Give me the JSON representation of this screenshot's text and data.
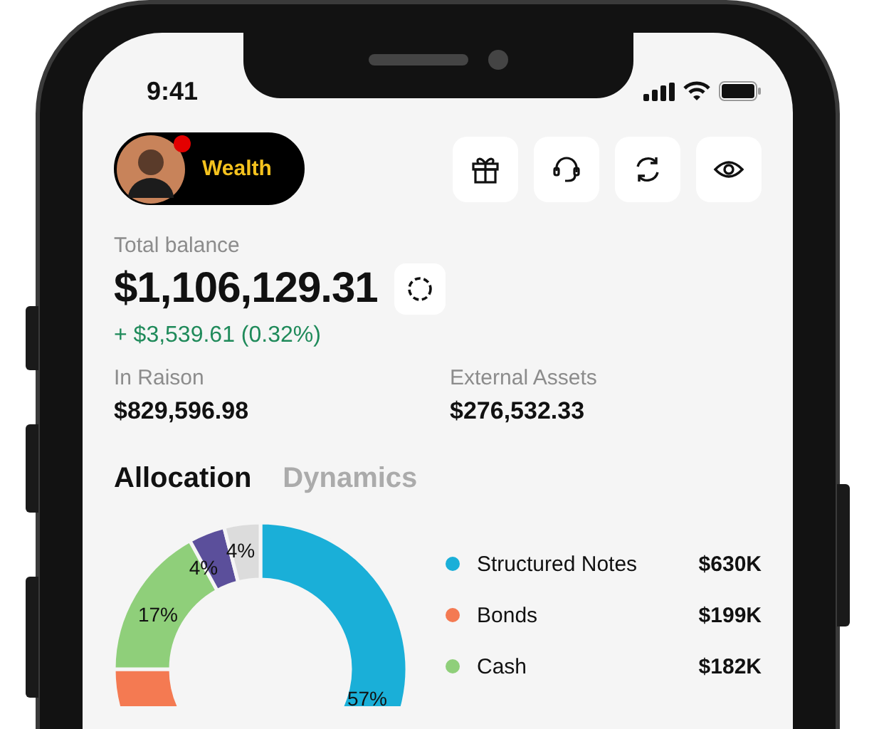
{
  "status_bar": {
    "time": "9:41"
  },
  "header": {
    "account_label": "Wealth",
    "notification": true
  },
  "balance": {
    "label": "Total balance",
    "value": "$1,106,129.31",
    "change": "+ $3,539.61 (0.32%)"
  },
  "breakdown": [
    {
      "label": "In Raison",
      "value": "$829,596.98"
    },
    {
      "label": "External Assets",
      "value": "$276,532.33"
    }
  ],
  "tabs": [
    {
      "label": "Allocation",
      "selected": true
    },
    {
      "label": "Dynamics",
      "selected": false
    }
  ],
  "allocation": {
    "chart_data": {
      "type": "donut",
      "values": [
        57,
        18,
        17,
        4,
        4
      ],
      "colors": [
        "#1aafd8",
        "#f47a52",
        "#8fcf7a",
        "#5b4f9b",
        "#dcdcdc"
      ],
      "value_labels": [
        "57%",
        null,
        "17%",
        "4%",
        "4%"
      ]
    },
    "legend": [
      {
        "name": "Structured Notes",
        "value": "$630K",
        "color": "#1aafd8"
      },
      {
        "name": "Bonds",
        "value": "$199K",
        "color": "#f47a52"
      },
      {
        "name": "Cash",
        "value": "$182K",
        "color": "#8fcf7a"
      }
    ]
  }
}
